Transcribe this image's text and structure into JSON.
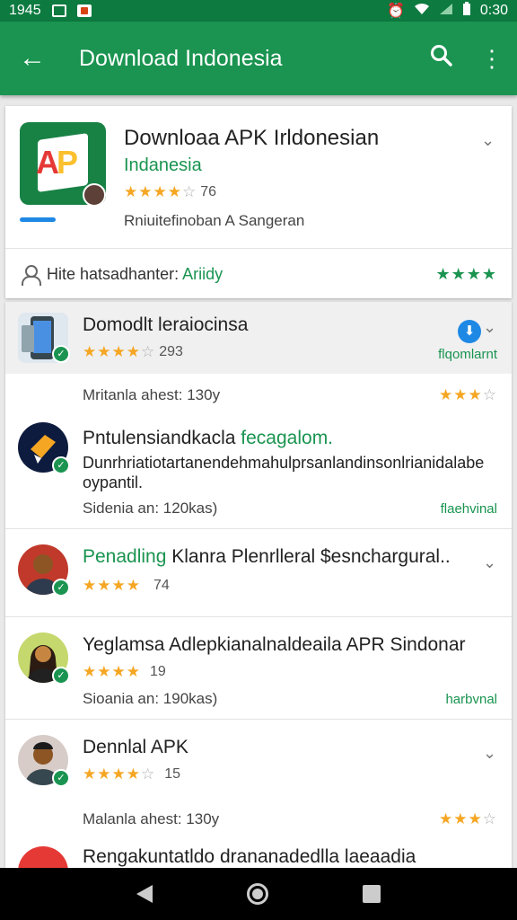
{
  "status_bar": {
    "time_left": "1945",
    "time_right": "0:30"
  },
  "app_bar": {
    "title": "Download Indonesia",
    "back_glyph": "←",
    "search_glyph": "⚲",
    "menu_glyph": "⋮"
  },
  "app_card": {
    "title": "Downloaa APK Irldonesian",
    "subtitle": "Indanesia",
    "rating": "76",
    "developer": "Rniuitefinoban A  Sangeran",
    "stat_label": "Hite hatsadhanter:",
    "stat_link": "Ariidy",
    "stat_stars": "★★★★"
  },
  "items": [
    {
      "title": "Domodlt leraiocinsa",
      "stars_on": "★★★★",
      "stars_off": "☆",
      "rating": "293",
      "green_label": "flqomlarnt",
      "meta_below": "Mritanla ahest: 130y",
      "meta_stars_on": "★★★",
      "meta_stars_off": "☆"
    },
    {
      "title_prefix": "Pntulensiandkacla ",
      "title_green": "fecagalom.",
      "desc": "Dunrhriatiotartanendehmahulprsanlandinsonlrianidalabe oypantil.",
      "meta": "Sidenia  an: 120kas)",
      "green_label": "flaehvinal"
    },
    {
      "title_green": "Penadling",
      "title_rest": " Klanra Plenrlleral $esnchargural..",
      "stars_on": "★★★★",
      "rating": "74"
    },
    {
      "title": "Yeglamsa Adlepkianalnaldeaila APR Sindonar",
      "stars_on": "★★★★",
      "rating": "19",
      "meta": "Sioania  an: 190kas)",
      "green_label": "harbvnal"
    },
    {
      "title": "Dennlal APK",
      "stars_on": "★★★★",
      "stars_off": "☆",
      "rating": "15",
      "meta_below": "Malanla ahest: 130y",
      "meta_stars_on": "★★★",
      "meta_stars_off": "☆"
    },
    {
      "title": "Rengakuntatldo drananadedlla laeaadia"
    }
  ],
  "colors": {
    "primary": "#1a9450",
    "primary_dark": "#0d7a40",
    "star": "#f5a623"
  }
}
